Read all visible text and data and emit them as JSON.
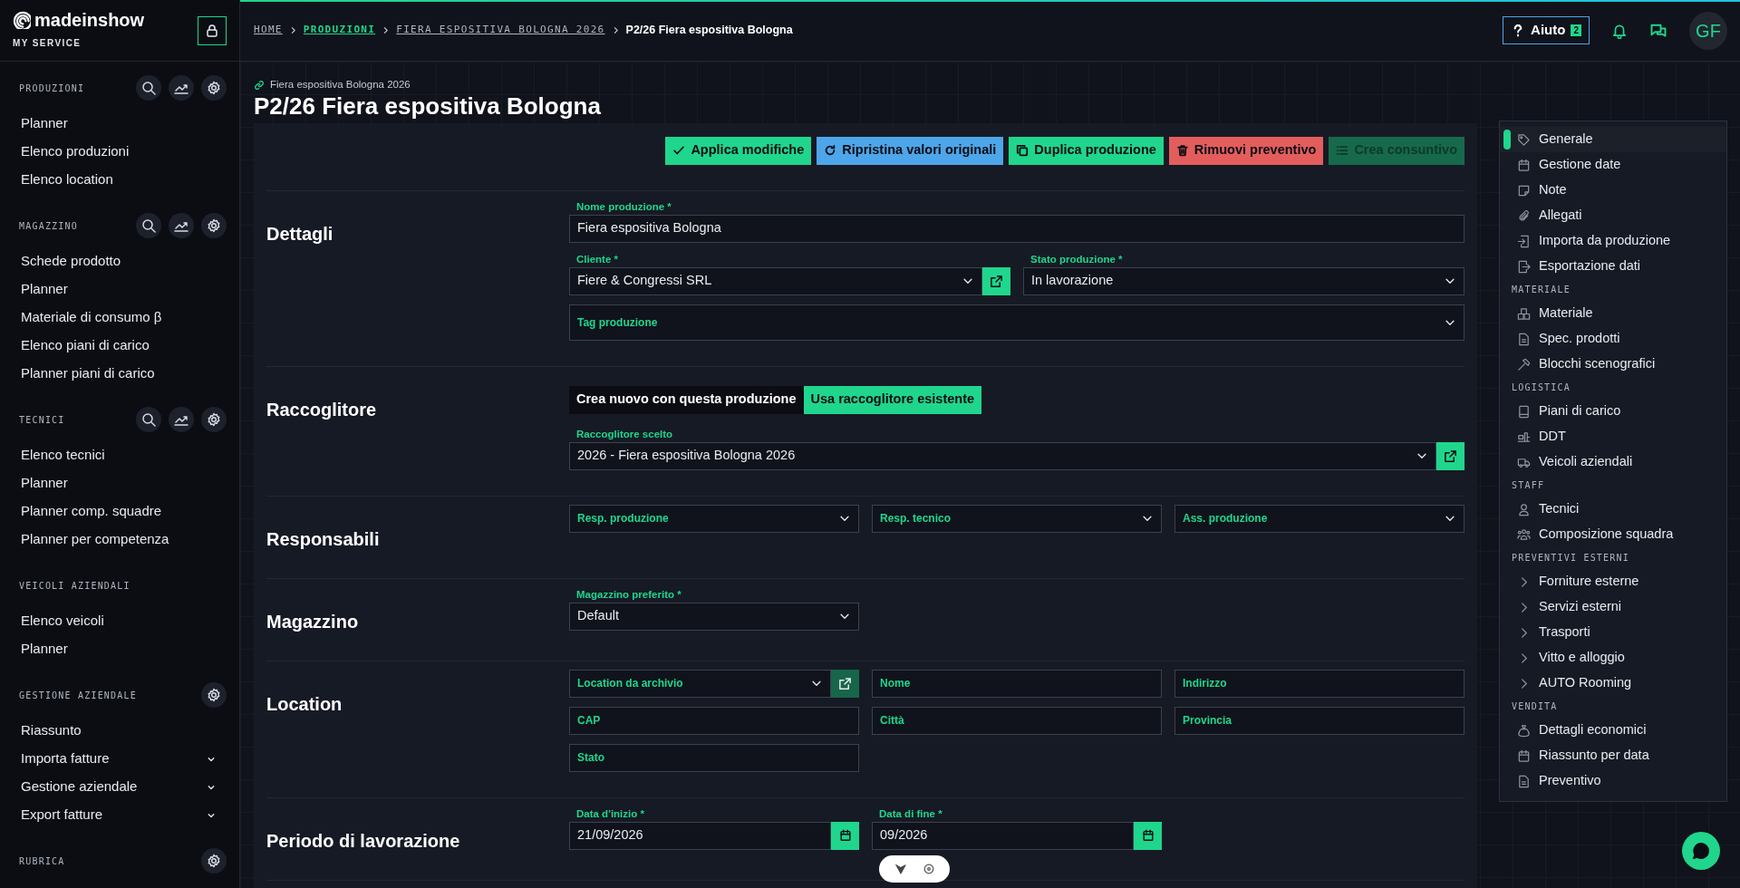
{
  "brand": {
    "name": "madeinshow",
    "subtitle": "MY SERVICE"
  },
  "sidebar": {
    "sections": [
      {
        "title": "PRODUZIONI",
        "tools": [
          {
            "kind": "search"
          },
          {
            "kind": "chart"
          },
          {
            "kind": "settings"
          }
        ],
        "items": [
          {
            "label": "Planner",
            "expandable": false
          },
          {
            "label": "Elenco produzioni",
            "expandable": false
          },
          {
            "label": "Elenco location",
            "expandable": false
          }
        ]
      },
      {
        "title": "MAGAZZINO",
        "tools": [
          {
            "kind": "search"
          },
          {
            "kind": "chart"
          },
          {
            "kind": "settings"
          }
        ],
        "items": [
          {
            "label": "Schede prodotto",
            "expandable": false
          },
          {
            "label": "Planner",
            "expandable": false
          },
          {
            "label": "Materiale di consumo β",
            "expandable": false
          },
          {
            "label": "Elenco piani di carico",
            "expandable": false
          },
          {
            "label": "Planner piani di carico",
            "expandable": false
          }
        ]
      },
      {
        "title": "TECNICI",
        "tools": [
          {
            "kind": "search"
          },
          {
            "kind": "chart"
          },
          {
            "kind": "settings"
          }
        ],
        "items": [
          {
            "label": "Elenco tecnici",
            "expandable": false
          },
          {
            "label": "Planner",
            "expandable": false
          },
          {
            "label": "Planner comp. squadre",
            "expandable": false
          },
          {
            "label": "Planner per competenza",
            "expandable": false
          }
        ]
      },
      {
        "title": "VEICOLI AZIENDALI",
        "items": [
          {
            "label": "Elenco veicoli",
            "expandable": false
          },
          {
            "label": "Planner",
            "expandable": false
          }
        ]
      },
      {
        "title": "GESTIONE AZIENDALE",
        "tools": [
          {
            "kind": "settings"
          }
        ],
        "items": [
          {
            "label": "Riassunto",
            "expandable": false
          },
          {
            "label": "Importa fatture",
            "expandable": true
          },
          {
            "label": "Gestione aziendale",
            "expandable": true
          },
          {
            "label": "Export fatture",
            "expandable": true
          }
        ]
      },
      {
        "title": "RUBRICA",
        "tools": [
          {
            "kind": "settings"
          }
        ]
      }
    ]
  },
  "breadcrumb": [
    {
      "label": "HOME",
      "kind": "plain"
    },
    {
      "label": "PRODUZIONI",
      "kind": "link"
    },
    {
      "label": "FIERA ESPOSITIVA BOLOGNA 2026",
      "kind": "plain"
    },
    {
      "label": "P2/26 Fiera espositiva Bologna",
      "kind": "current"
    }
  ],
  "topbar": {
    "help": {
      "label": "Aiuto",
      "count": "2"
    },
    "avatar": "GF"
  },
  "page": {
    "parent": "Fiera espositiva Bologna 2026",
    "title": "P2/26 Fiera espositiva Bologna"
  },
  "actions": [
    {
      "label": "Applica modifiche",
      "kind": "check",
      "color": "#1fd68c",
      "disabled": false
    },
    {
      "label": "Ripristina valori originali",
      "kind": "refresh",
      "color": "#4da6ea",
      "disabled": false
    },
    {
      "label": "Duplica produzione",
      "kind": "copy",
      "color": "#1fd68c",
      "disabled": false
    },
    {
      "label": "Rimuovi preventivo",
      "kind": "trash",
      "color": "#e35d5d",
      "disabled": false
    },
    {
      "label": "Crea consuntivo",
      "kind": "list",
      "color": "#17694c",
      "disabled": true
    }
  ],
  "sections": [
    {
      "title": "Dettagli",
      "rows": [
        [
          {
            "label": "Nome produzione *",
            "kind": "text",
            "value": "Fiera espositiva Bologna"
          }
        ],
        [
          {
            "label": "Cliente *",
            "kind": "select",
            "value": "Fiere & Congressi SRL",
            "link": {
              "disabled": false
            }
          },
          {
            "label": "Stato produzione *",
            "kind": "select",
            "value": "In lavorazione"
          }
        ],
        [
          {
            "label": "Tag produzione",
            "kind": "tags"
          }
        ]
      ]
    },
    {
      "title": "Raccoglitore",
      "toggle": [
        {
          "label": "Crea nuovo con questa produzione",
          "selected": false
        },
        {
          "label": "Usa raccoglitore esistente",
          "selected": true
        }
      ],
      "rows": [
        [
          {
            "label": "Raccoglitore scelto",
            "kind": "select",
            "value": "2026 - Fiera espositiva Bologna 2026",
            "link": {
              "disabled": false
            }
          }
        ]
      ]
    },
    {
      "title": "Responsabili",
      "rows": [
        [
          {
            "label": "Resp. produzione",
            "kind": "select"
          },
          {
            "label": "Resp. tecnico",
            "kind": "select"
          },
          {
            "label": "Ass. produzione",
            "kind": "select"
          }
        ]
      ]
    },
    {
      "title": "Magazzino",
      "rows": [
        [
          {
            "label": "Magazzino preferito *",
            "kind": "select",
            "value": "Default"
          }
        ]
      ]
    },
    {
      "title": "Location",
      "rows": [
        [
          {
            "label": "Location da archivio",
            "kind": "select",
            "link": {
              "disabled": true
            }
          },
          {
            "label": "Nome",
            "kind": "text"
          },
          {
            "label": "Indirizzo",
            "kind": "text"
          }
        ],
        [
          {
            "label": "CAP",
            "kind": "text"
          },
          {
            "label": "Città",
            "kind": "text"
          },
          {
            "label": "Provincia",
            "kind": "text"
          }
        ],
        [
          {
            "label": "Stato",
            "kind": "text"
          }
        ]
      ]
    },
    {
      "title": "Periodo di lavorazione",
      "rows": [
        [
          {
            "label": "Data d'inizio *",
            "kind": "date",
            "value": "21/09/2026"
          },
          {
            "label": "Data di fine *",
            "kind": "date",
            "value": "09/2026"
          }
        ]
      ]
    }
  ],
  "nav": {
    "groups": [
      {
        "items": [
          {
            "label": "Generale",
            "selected": true,
            "expandable": false
          },
          {
            "label": "Gestione date",
            "selected": false,
            "expandable": false
          },
          {
            "label": "Note",
            "selected": false,
            "expandable": false
          },
          {
            "label": "Allegati",
            "selected": false,
            "expandable": false
          },
          {
            "label": "Importa da produzione",
            "selected": false,
            "expandable": false
          },
          {
            "label": "Esportazione dati",
            "selected": false,
            "expandable": false
          }
        ]
      },
      {
        "title": "MATERIALE",
        "items": [
          {
            "label": "Materiale",
            "selected": false,
            "expandable": false
          },
          {
            "label": "Spec. prodotti",
            "selected": false,
            "expandable": false
          },
          {
            "label": "Blocchi scenografici",
            "selected": false,
            "expandable": false
          }
        ]
      },
      {
        "title": "LOGISTICA",
        "items": [
          {
            "label": "Piani di carico",
            "selected": false,
            "expandable": false
          },
          {
            "label": "DDT",
            "selected": false,
            "expandable": false
          },
          {
            "label": "Veicoli aziendali",
            "selected": false,
            "expandable": false
          }
        ]
      },
      {
        "title": "STAFF",
        "items": [
          {
            "label": "Tecnici",
            "selected": false,
            "expandable": false
          },
          {
            "label": "Composizione squadra",
            "selected": false,
            "expandable": false
          }
        ]
      },
      {
        "title": "PREVENTIVI ESTERNI",
        "items": [
          {
            "label": "Forniture esterne",
            "selected": false,
            "expandable": true
          },
          {
            "label": "Servizi esterni",
            "selected": false,
            "expandable": true
          },
          {
            "label": "Trasporti",
            "selected": false,
            "expandable": true
          },
          {
            "label": "Vitto e alloggio",
            "selected": false,
            "expandable": true
          },
          {
            "label": "AUTO Rooming",
            "selected": false,
            "expandable": true
          }
        ]
      },
      {
        "title": "VENDITA",
        "items": [
          {
            "label": "Dettagli economici",
            "selected": false,
            "expandable": false
          },
          {
            "label": "Riassunto per data",
            "selected": false,
            "expandable": false
          },
          {
            "label": "Preventivo",
            "selected": false,
            "expandable": false
          }
        ]
      }
    ]
  }
}
